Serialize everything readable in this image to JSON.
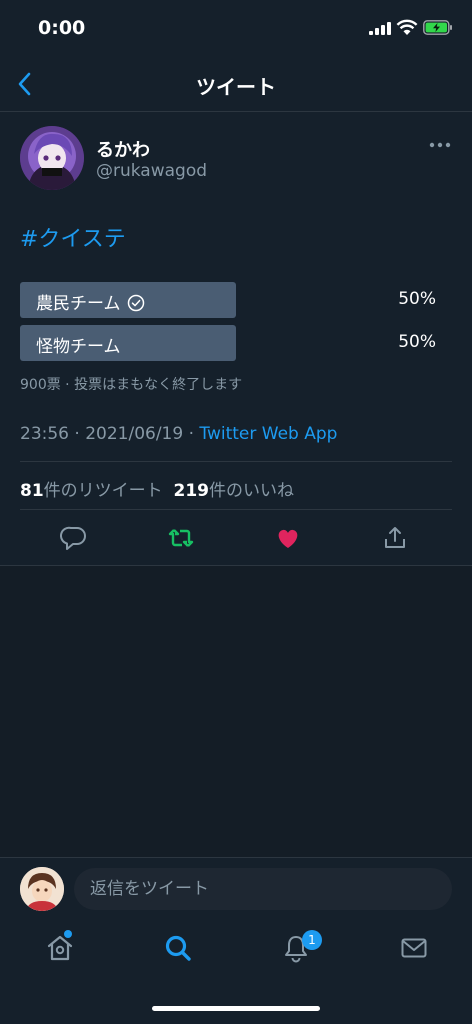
{
  "status_bar": {
    "time": "0:00"
  },
  "header": {
    "title": "ツイート"
  },
  "tweet": {
    "author_name": "るかわ",
    "author_handle": "@rukawagod",
    "text": "#クイステ",
    "poll": {
      "options": [
        {
          "label": "農民チーム",
          "percent": "50%",
          "fraction": 0.5,
          "voted": true
        },
        {
          "label": "怪物チーム",
          "percent": "50%",
          "fraction": 0.5,
          "voted": false
        }
      ],
      "meta": "900票 · 投票はまもなく終了します"
    },
    "timestamp": "23:56 · 2021/06/19 · ",
    "source": "Twitter Web App",
    "retweet_count": "81",
    "retweet_label": "件のリツイート",
    "like_count": "219",
    "like_label": "件のいいね"
  },
  "reply": {
    "placeholder": "返信をツイート"
  },
  "tab_bar": {
    "notification_badge": "1"
  },
  "colors": {
    "accent": "#1d9bf0",
    "retweet": "#17bf63",
    "like": "#e0245e",
    "background": "#15202b"
  },
  "icons": [
    "back-icon",
    "more-icon",
    "check-icon",
    "reply-icon",
    "retweet-icon",
    "like-icon",
    "share-icon",
    "home-icon",
    "search-icon",
    "bell-icon",
    "mail-icon"
  ]
}
